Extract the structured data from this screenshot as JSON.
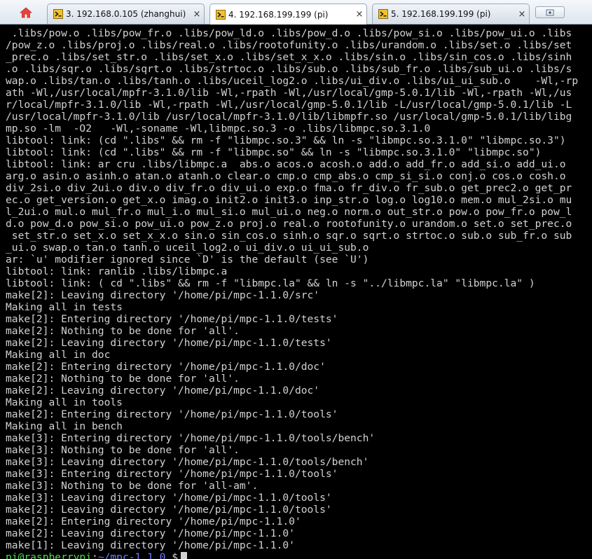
{
  "colors": {
    "terminal_bg": "#000000",
    "terminal_fg": "#d2d2d2",
    "prompt_user": "#4fd84f",
    "prompt_path": "#6f7bff",
    "tab_active_bg": "#ffffff",
    "tab_bg": "#dde3eb"
  },
  "icons": {
    "home": "home-icon",
    "tab": "terminal-session-icon",
    "close": "close-icon",
    "new_tab": "new-tab-icon"
  },
  "tabs": [
    {
      "label": "3. 192.168.0.105 (zhanghui)",
      "close": "×",
      "active": false
    },
    {
      "label": "4. 192.168.199.199 (pi)",
      "close": "×",
      "active": true
    },
    {
      "label": "5. 192.168.199.199 (pi)",
      "close": "×",
      "active": false
    }
  ],
  "terminal": {
    "lines": [
      " .libs/pow.o .libs/pow_fr.o .libs/pow_ld.o .libs/pow_d.o .libs/pow_si.o .libs/pow_ui.o .libs",
      "/pow_z.o .libs/proj.o .libs/real.o .libs/rootofunity.o .libs/urandom.o .libs/set.o .libs/set",
      "_prec.o .libs/set_str.o .libs/set_x.o .libs/set_x_x.o .libs/sin.o .libs/sin_cos.o .libs/sinh",
      ".o .libs/sqr.o .libs/sqrt.o .libs/strtoc.o .libs/sub.o .libs/sub_fr.o .libs/sub_ui.o .libs/s",
      "wap.o .libs/tan.o .libs/tanh.o .libs/uceil_log2.o .libs/ui_div.o .libs/ui_ui_sub.o    -Wl,-rp",
      "ath -Wl,/usr/local/mpfr-3.1.0/lib -Wl,-rpath -Wl,/usr/local/gmp-5.0.1/lib -Wl,-rpath -Wl,/us",
      "r/local/mpfr-3.1.0/lib -Wl,-rpath -Wl,/usr/local/gmp-5.0.1/lib -L/usr/local/gmp-5.0.1/lib -L",
      "/usr/local/mpfr-3.1.0/lib /usr/local/mpfr-3.1.0/lib/libmpfr.so /usr/local/gmp-5.0.1/lib/libg",
      "mp.so -lm  -O2   -Wl,-soname -Wl,libmpc.so.3 -o .libs/libmpc.so.3.1.0",
      "libtool: link: (cd \".libs\" && rm -f \"libmpc.so.3\" && ln -s \"libmpc.so.3.1.0\" \"libmpc.so.3\")",
      "libtool: link: (cd \".libs\" && rm -f \"libmpc.so\" && ln -s \"libmpc.so.3.1.0\" \"libmpc.so\")",
      "libtool: link: ar cru .libs/libmpc.a  abs.o acos.o acosh.o add.o add_fr.o add_si.o add_ui.o",
      "arg.o asin.o asinh.o atan.o atanh.o clear.o cmp.o cmp_abs.o cmp_si_si.o conj.o cos.o cosh.o",
      "div_2si.o div_2ui.o div.o div_fr.o div_ui.o exp.o fma.o fr_div.o fr_sub.o get_prec2.o get_pr",
      "ec.o get_version.o get_x.o imag.o init2.o init3.o inp_str.o log.o log10.o mem.o mul_2si.o mu",
      "l_2ui.o mul.o mul_fr.o mul_i.o mul_si.o mul_ui.o neg.o norm.o out_str.o pow.o pow_fr.o pow_l",
      "d.o pow_d.o pow_si.o pow_ui.o pow_z.o proj.o real.o rootofunity.o urandom.o set.o set_prec.o",
      " set_str.o set_x.o set_x_x.o sin.o sin_cos.o sinh.o sqr.o sqrt.o strtoc.o sub.o sub_fr.o sub",
      "_ui.o swap.o tan.o tanh.o uceil_log2.o ui_div.o ui_ui_sub.o",
      "ar: `u' modifier ignored since `D' is the default (see `U')",
      "libtool: link: ranlib .libs/libmpc.a",
      "libtool: link: ( cd \".libs\" && rm -f \"libmpc.la\" && ln -s \"../libmpc.la\" \"libmpc.la\" )",
      "make[2]: Leaving directory '/home/pi/mpc-1.1.0/src'",
      "Making all in tests",
      "make[2]: Entering directory '/home/pi/mpc-1.1.0/tests'",
      "make[2]: Nothing to be done for 'all'.",
      "make[2]: Leaving directory '/home/pi/mpc-1.1.0/tests'",
      "Making all in doc",
      "make[2]: Entering directory '/home/pi/mpc-1.1.0/doc'",
      "make[2]: Nothing to be done for 'all'.",
      "make[2]: Leaving directory '/home/pi/mpc-1.1.0/doc'",
      "Making all in tools",
      "make[2]: Entering directory '/home/pi/mpc-1.1.0/tools'",
      "Making all in bench",
      "make[3]: Entering directory '/home/pi/mpc-1.1.0/tools/bench'",
      "make[3]: Nothing to be done for 'all'.",
      "make[3]: Leaving directory '/home/pi/mpc-1.1.0/tools/bench'",
      "make[3]: Entering directory '/home/pi/mpc-1.1.0/tools'",
      "make[3]: Nothing to be done for 'all-am'.",
      "make[3]: Leaving directory '/home/pi/mpc-1.1.0/tools'",
      "make[2]: Leaving directory '/home/pi/mpc-1.1.0/tools'",
      "make[2]: Entering directory '/home/pi/mpc-1.1.0'",
      "make[2]: Leaving directory '/home/pi/mpc-1.1.0'",
      "make[1]: Leaving directory '/home/pi/mpc-1.1.0'"
    ],
    "prompt": {
      "user_host": "pi@raspberrypi",
      "path": "~/mpc-1.1.0",
      "symbol": "$"
    }
  }
}
